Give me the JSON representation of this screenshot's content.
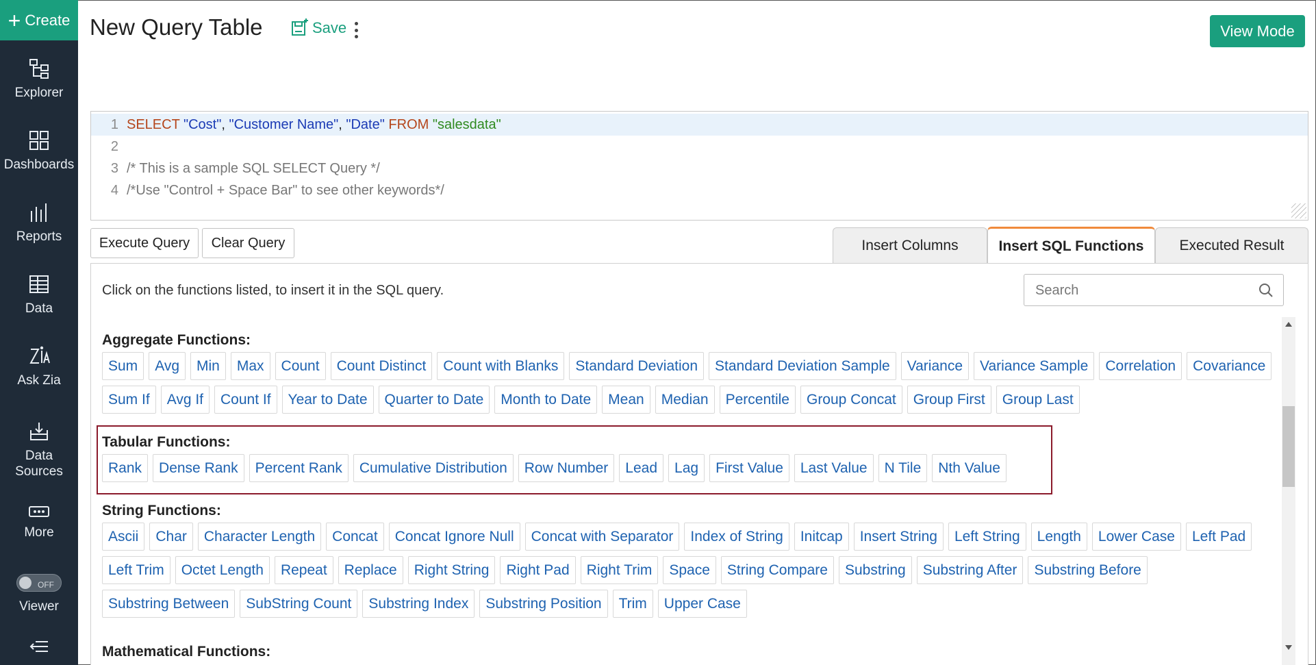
{
  "sidebar": {
    "create_label": "Create",
    "items": [
      {
        "label": "Explorer",
        "icon": "explorer-icon"
      },
      {
        "label": "Dashboards",
        "icon": "dashboards-icon"
      },
      {
        "label": "Reports",
        "icon": "reports-icon"
      },
      {
        "label": "Data",
        "icon": "data-table-icon"
      },
      {
        "label": "Ask Zia",
        "icon": "ask-zia-icon"
      },
      {
        "label": "Data\nSources",
        "icon": "data-sources-icon"
      },
      {
        "label": "More",
        "icon": "more-icon"
      },
      {
        "label": "Viewer",
        "icon": "viewer-toggle"
      }
    ],
    "viewer_toggle_state": "OFF"
  },
  "header": {
    "title": "New Query Table",
    "save_label": "Save",
    "view_mode_label": "View Mode"
  },
  "editor": {
    "lines": [
      {
        "num": "1"
      },
      {
        "num": "2"
      },
      {
        "num": "3",
        "text": "/* This is a sample SQL SELECT Query */"
      },
      {
        "num": "4",
        "text": "/*Use \"Control + Space Bar\" to see other keywords*/"
      }
    ],
    "line1": {
      "select": "SELECT",
      "c1": "\"Cost\"",
      "sep1": ", ",
      "c2": "\"Customer Name\"",
      "sep2": ", ",
      "c3": "\"Date\"",
      "from": "FROM",
      "table": "\"salesdata\""
    }
  },
  "actions": {
    "execute_label": "Execute Query",
    "clear_label": "Clear Query"
  },
  "tabs": [
    {
      "label": "Insert Columns"
    },
    {
      "label": "Insert SQL Functions"
    },
    {
      "label": "Executed Result"
    }
  ],
  "panel": {
    "hint": "Click on the functions listed, to insert it in the SQL query.",
    "search_placeholder": "Search"
  },
  "groups": {
    "aggregate": {
      "title": "Aggregate Functions:",
      "items": [
        "Sum",
        "Avg",
        "Min",
        "Max",
        "Count",
        "Count Distinct",
        "Count with Blanks",
        "Standard Deviation",
        "Standard Deviation Sample",
        "Variance",
        "Variance Sample",
        "Correlation",
        "Covariance",
        "Sum If",
        "Avg If",
        "Count If",
        "Year to Date",
        "Quarter to Date",
        "Month to Date",
        "Mean",
        "Median",
        "Percentile",
        "Group Concat",
        "Group First",
        "Group Last"
      ]
    },
    "tabular": {
      "title": "Tabular Functions:",
      "items": [
        "Rank",
        "Dense Rank",
        "Percent Rank",
        "Cumulative Distribution",
        "Row Number",
        "Lead",
        "Lag",
        "First Value",
        "Last Value",
        "N Tile",
        "Nth Value"
      ]
    },
    "string": {
      "title": "String Functions:",
      "items": [
        "Ascii",
        "Char",
        "Character Length",
        "Concat",
        "Concat Ignore Null",
        "Concat with Separator",
        "Index of String",
        "Initcap",
        "Insert String",
        "Left String",
        "Length",
        "Lower Case",
        "Left Pad",
        "Left Trim",
        "Octet Length",
        "Repeat",
        "Replace",
        "Right String",
        "Right Pad",
        "Right Trim",
        "Space",
        "String Compare",
        "Substring",
        "Substring After",
        "Substring Before",
        "Substring Between",
        "SubString Count",
        "Substring Index",
        "Substring Position",
        "Trim",
        "Upper Case"
      ]
    },
    "math": {
      "title": "Mathematical Functions:"
    }
  },
  "colors": {
    "sidebar_bg": "#1f2b38",
    "accent": "#1a9f7e",
    "link": "#1e62b0",
    "highlight": "#8b1a2b",
    "active_tab": "#f08a3c"
  }
}
